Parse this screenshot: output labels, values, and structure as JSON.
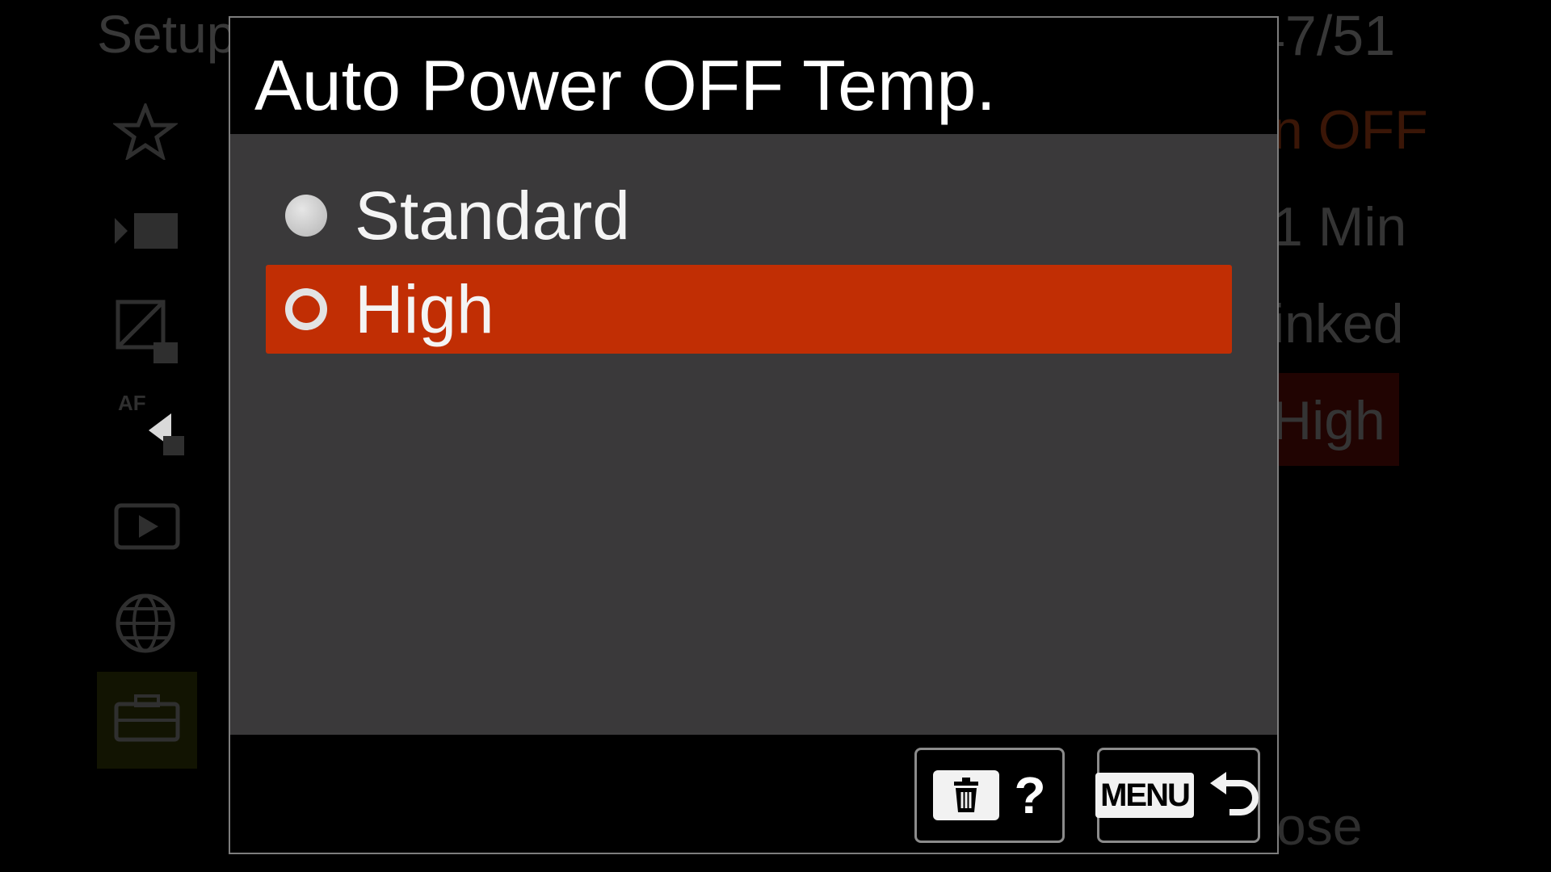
{
  "background_menu": {
    "category_title": "Setup",
    "page_indicator": "47/51",
    "values": [
      "n OFF",
      "1 Min",
      "inked",
      "High"
    ],
    "close_label": "ose",
    "left_arrow": "◀",
    "af_label": "AF"
  },
  "dialog": {
    "title": "Auto Power OFF Temp.",
    "options": [
      {
        "label": "Standard",
        "selected": false
      },
      {
        "label": "High",
        "selected": true
      }
    ],
    "help_label": "?",
    "menu_key_label": "MENU"
  },
  "colors": {
    "selection": "#c12e04",
    "panel": "#3a393a",
    "background": "#000000"
  },
  "icons": {
    "delete": "trash-icon",
    "back": "return-arrow-icon"
  }
}
